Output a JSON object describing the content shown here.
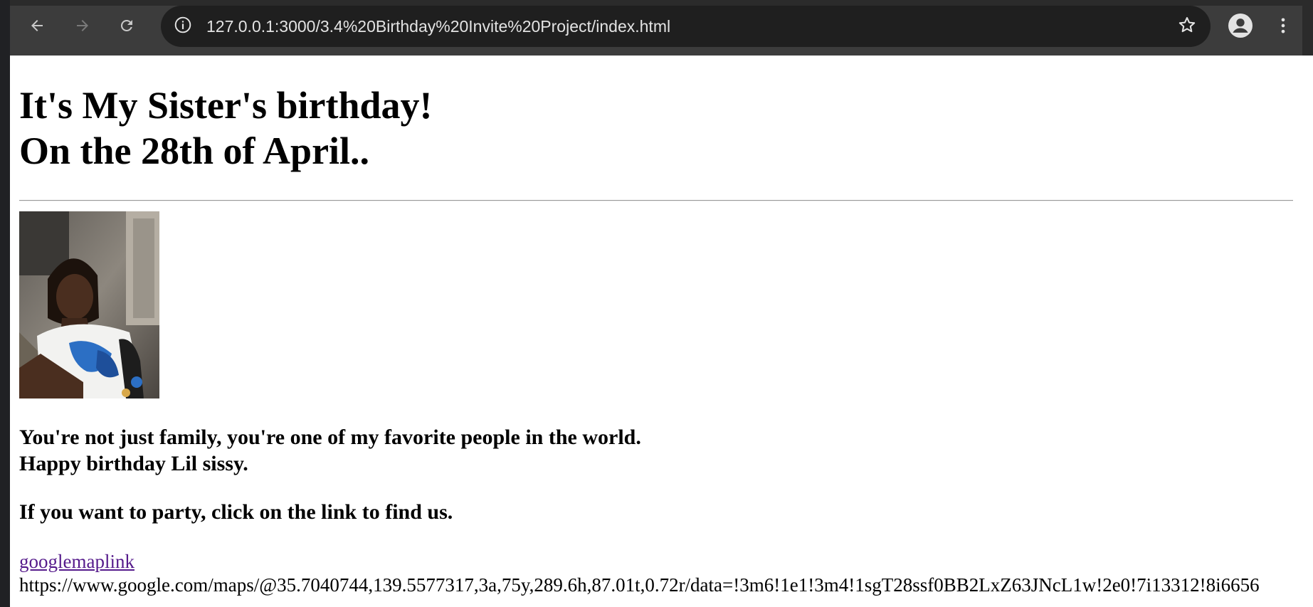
{
  "browser": {
    "url": "127.0.0.1:3000/3.4%20Birthday%20Invite%20Project/index.html",
    "icons": {
      "back": "back-arrow-icon",
      "forward": "forward-arrow-icon",
      "reload": "reload-icon",
      "site_info": "info-icon",
      "bookmark": "star-icon",
      "profile": "profile-icon",
      "menu": "kebab-menu-icon"
    }
  },
  "page": {
    "heading_line1": "It's My Sister's birthday!",
    "heading_line2": "On the 28th of April..",
    "photo_name": "sister-photo",
    "message_line1": "You're not just family, you're one of my favorite people in the world.",
    "message_line2": "Happy birthday Lil sissy.",
    "party_text": "If you want to party, click on the link to find us.",
    "link_text": "googlemaplink",
    "raw_url_text": "https://www.google.com/maps/@35.7040744,139.5577317,3a,75y,289.6h,87.01t,0.72r/data=!3m6!1e1!3m4!1sgT28ssf0BB2LxZ63JNcL1w!2e0!7i13312!8i6656"
  },
  "colors": {
    "toolbar": "#3c3c3c",
    "omnibox": "#1f1f1f",
    "visited_link": "#551a8b",
    "page_bg": "#ffffff"
  }
}
